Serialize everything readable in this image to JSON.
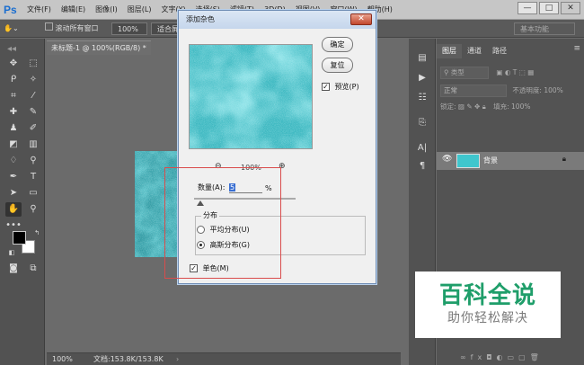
{
  "app": {
    "logo": "Ps"
  },
  "menu": [
    "文件(F)",
    "编辑(E)",
    "图像(I)",
    "图层(L)",
    "文字(Y)",
    "选择(S)",
    "滤镜(T)",
    "3D(D)",
    "视图(V)",
    "窗口(W)",
    "帮助(H)"
  ],
  "window_buttons": {
    "minimize": "—",
    "restore": "□",
    "close": "✕"
  },
  "options_bar": {
    "scroll_all_label": "滚动所有窗口",
    "zoom_value": "100%",
    "fit_screen_label": "适合屏",
    "workspace": "基本功能"
  },
  "document": {
    "tab_title": "未标题-1 @ 100%(RGB/8) *",
    "tab_close": "×"
  },
  "status_bar": {
    "zoom": "100%",
    "doc_info": "文档:153.8K/153.8K"
  },
  "panel": {
    "tabs": [
      "图层",
      "通道",
      "路径"
    ],
    "filter_kind": "类型",
    "blend_mode": "正常",
    "opacity_label": "不透明度:",
    "opacity_value": "100%",
    "lock_label": "锁定:",
    "fill_label": "填充:",
    "fill_value": "100%",
    "layer_name": "背景"
  },
  "dialog": {
    "title": "添加杂色",
    "ok_label": "确定",
    "reset_label": "复位",
    "preview_label": "预览(P)",
    "preview_checked": true,
    "zoom_value": "100%",
    "zoom_out": "−",
    "zoom_in": "+",
    "amount_label": "数量(A):",
    "amount_value": "5",
    "amount_unit": "%",
    "distribution_label": "分布",
    "uniform_label": "平均分布(U)",
    "gaussian_label": "高斯分布(G)",
    "selected_distribution": "gaussian",
    "mono_label": "单色(M)",
    "mono_checked": true,
    "noise_color": "#3fc6cd"
  },
  "watermark": {
    "title": "百科全说",
    "subtitle": "助你轻松解决"
  }
}
